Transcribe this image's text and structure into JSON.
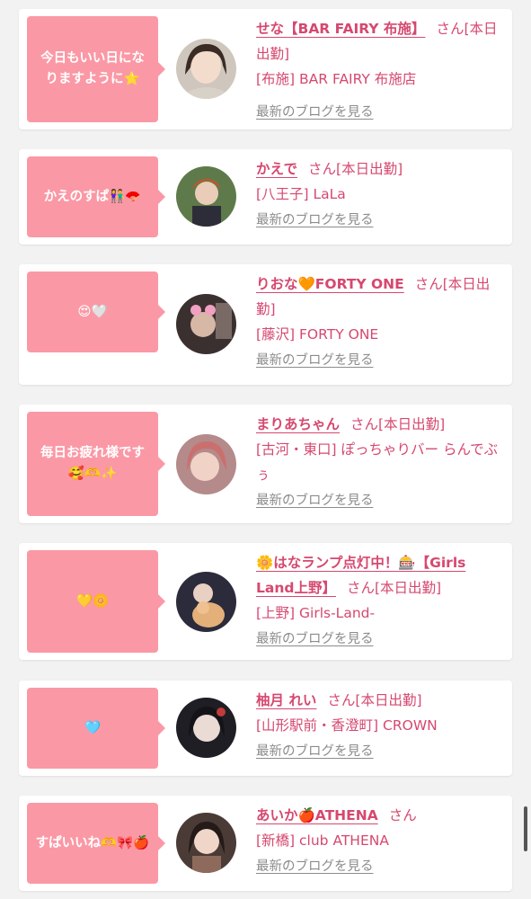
{
  "cards": [
    {
      "message": "今日もいい日になりますように⭐",
      "name": "せな【BAR FAIRY 布施】",
      "san": "さん[本日出勤]",
      "shop": "[布施] BAR FAIRY 布施店",
      "blog": "最新のブログを見る"
    },
    {
      "message": "かえのすぱ👫🪭",
      "name": "かえで",
      "san": "さん[本日出勤]",
      "shop": "[八王子] LaLa",
      "blog": "最新のブログを見る"
    },
    {
      "message": "😍🤍",
      "name": "りおな🧡FORTY ONE",
      "san": "さん[本日出勤]",
      "shop": "[藤沢] FORTY ONE",
      "blog": "最新のブログを見る"
    },
    {
      "message": "毎日お疲れ様です🥰🫶✨",
      "name": "まりあちゃん",
      "san": "さん[本日出勤]",
      "shop": "[古河・東口] ぽっちゃりバー らんでぶぅ",
      "blog": "最新のブログを見る"
    },
    {
      "message": "💛🌼",
      "name": "🌼はなランプ点灯中！🎰【Girls Land上野】",
      "san": "さん[本日出勤]",
      "shop": "[上野] Girls-Land-",
      "blog": "最新のブログを見る"
    },
    {
      "message": "🩵",
      "name": "柚月 れい",
      "san": "さん[本日出勤]",
      "shop": "[山形駅前・香澄町] CROWN",
      "blog": "最新のブログを見る"
    },
    {
      "message": "すぱいいね🫶🎀🍎",
      "name": "あいか🍎ATHENA",
      "san": "さん",
      "shop": "[新橋] club ATHENA",
      "blog": "最新のブログを見る"
    }
  ],
  "colors": {
    "accent": "#d6486f",
    "bubble": "#fb98a5",
    "link_gray": "#8c8c8c",
    "background": "#f2f2f2"
  }
}
